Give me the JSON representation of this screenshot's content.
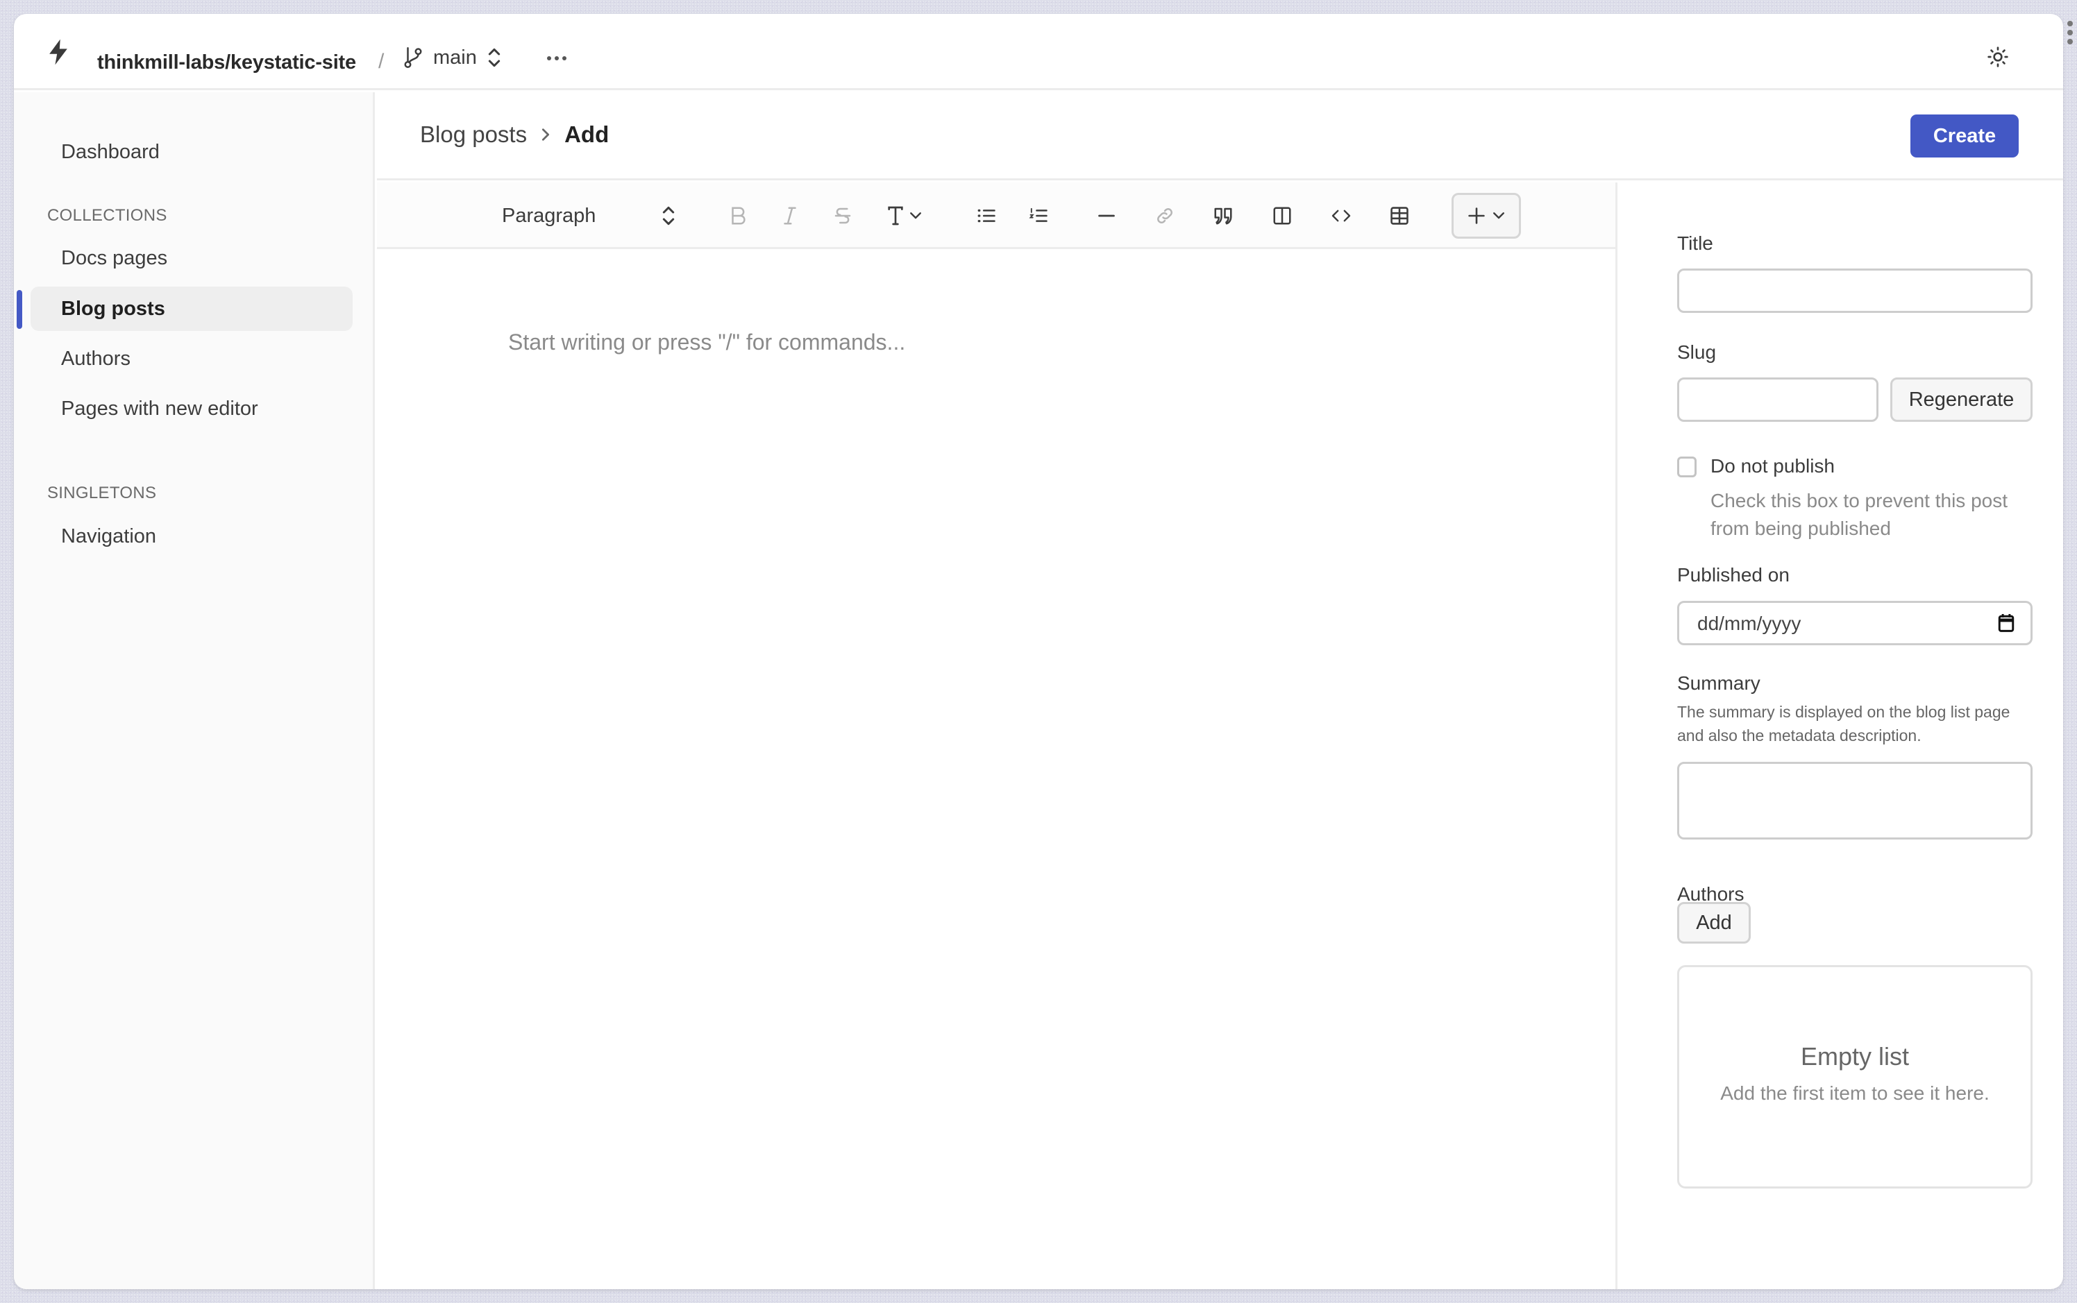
{
  "header": {
    "repo": "thinkmill-labs/keystatic-site",
    "separator": "/",
    "branch": "main",
    "more_label": "More actions",
    "theme_label": "Toggle theme"
  },
  "sidebar": {
    "dashboard": "Dashboard",
    "collections_heading": "COLLECTIONS",
    "collections": [
      {
        "label": "Docs pages",
        "active": false
      },
      {
        "label": "Blog posts",
        "active": true
      },
      {
        "label": "Authors",
        "active": false
      },
      {
        "label": "Pages with new editor",
        "active": false
      }
    ],
    "singletons_heading": "SINGLETONS",
    "singletons": [
      {
        "label": "Navigation",
        "active": false
      }
    ]
  },
  "page": {
    "breadcrumb": [
      "Blog posts",
      "Add"
    ],
    "create_label": "Create"
  },
  "toolbar": {
    "block_type": "Paragraph",
    "buttons": [
      "bold",
      "italic",
      "strikethrough",
      "text-style",
      "bulleted-list",
      "numbered-list",
      "divider",
      "link",
      "blockquote",
      "columns",
      "code-block",
      "table",
      "insert"
    ]
  },
  "editor": {
    "placeholder": "Start writing or press \"/\" for commands..."
  },
  "form": {
    "title_label": "Title",
    "title_value": "",
    "slug_label": "Slug",
    "slug_value": "",
    "regenerate_label": "Regenerate",
    "do_not_publish_label": "Do not publish",
    "do_not_publish_checked": false,
    "do_not_publish_help": "Check this box to prevent this post from being published",
    "published_on_label": "Published on",
    "published_on_placeholder": "dd/mm/yyyy",
    "summary_label": "Summary",
    "summary_help": "The summary is displayed on the blog list page and also the metadata description.",
    "summary_value": "",
    "authors_label": "Authors",
    "authors_add_label": "Add",
    "authors_empty_title": "Empty list",
    "authors_empty_sub": "Add the first item to see it here."
  },
  "colors": {
    "accent": "#4358c5",
    "sidebar_bg": "#fafafa",
    "active_item_bg": "#eeeeee",
    "border": "#ececec"
  }
}
